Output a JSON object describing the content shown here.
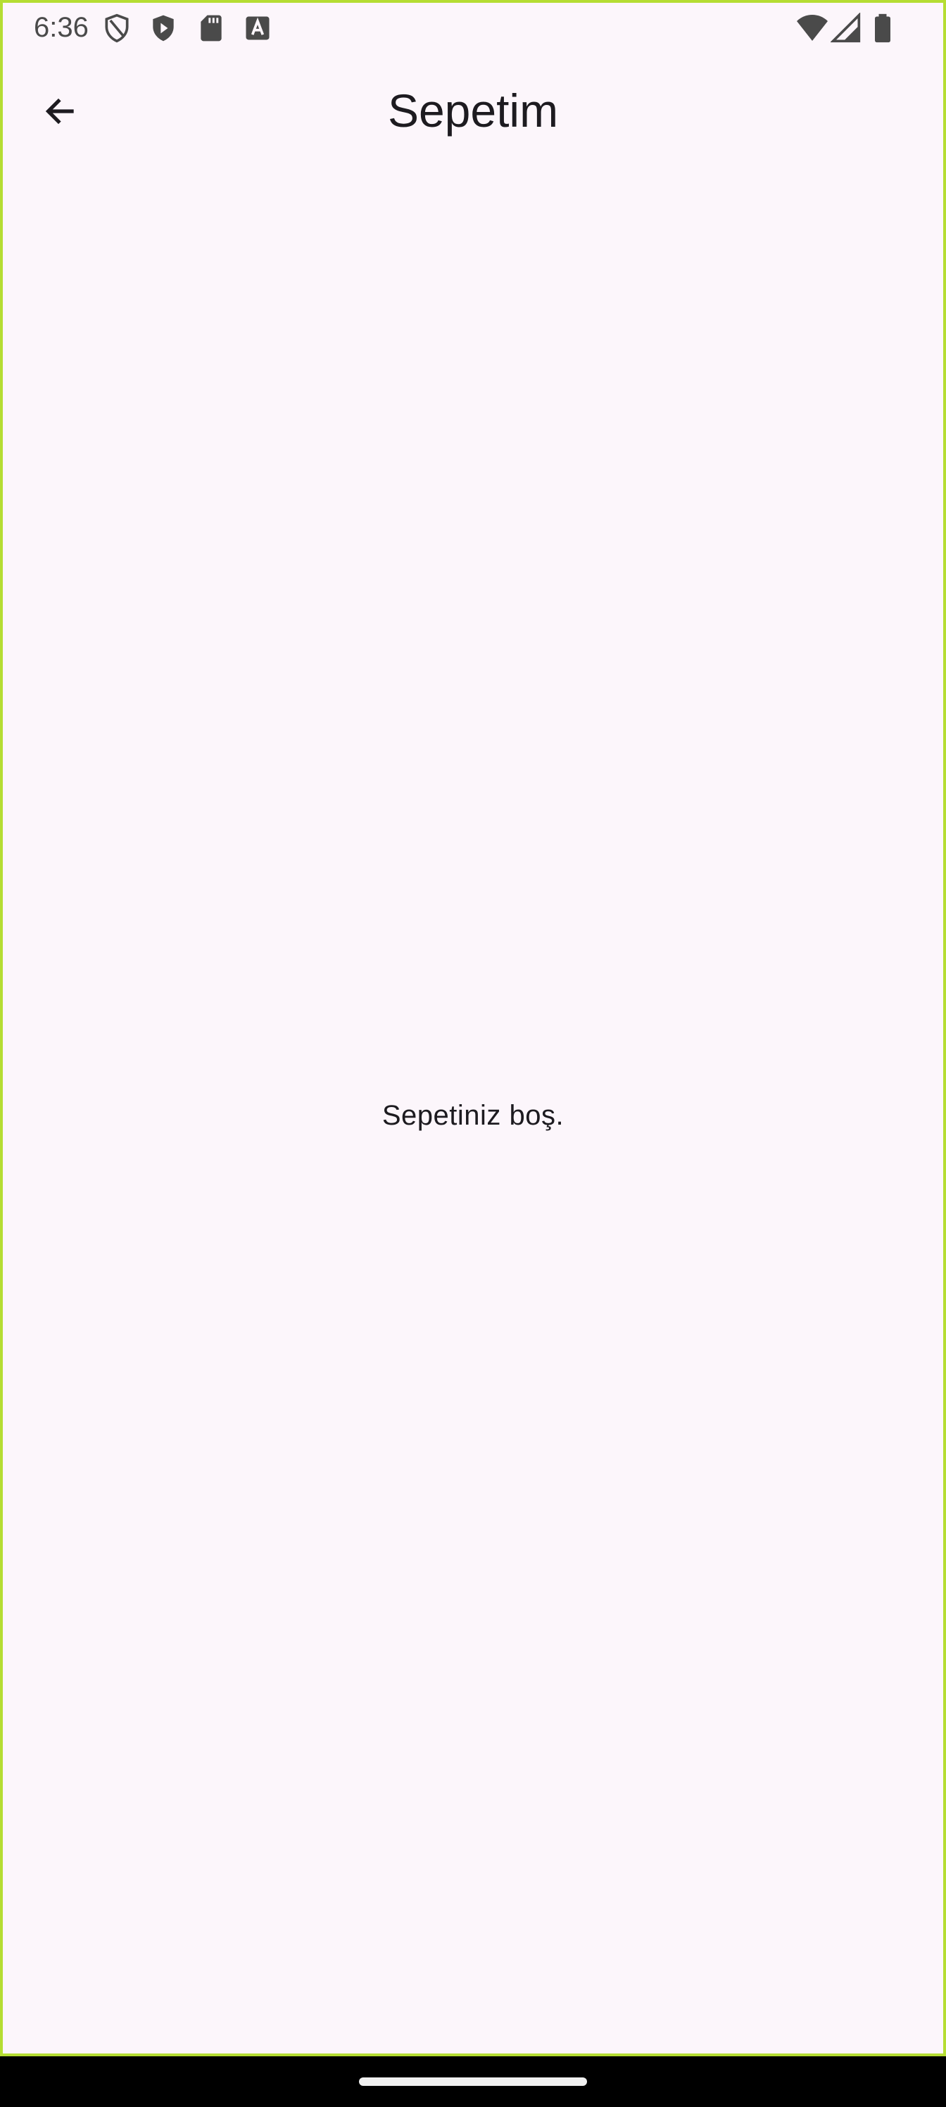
{
  "status_bar": {
    "time": "6:36",
    "left_icons": [
      "shield-outline-icon",
      "play-protect-icon",
      "sd-card-icon",
      "text-a-icon"
    ],
    "right_icons": [
      "wifi-icon",
      "signal-icon",
      "battery-icon"
    ]
  },
  "app_bar": {
    "back_icon": "arrow-left-icon",
    "title": "Sepetim"
  },
  "main": {
    "empty_message": "Sepetiniz boş."
  },
  "colors": {
    "background": "#fcf6fb",
    "frame_border": "#b5dd33",
    "text_primary": "#1d1b20",
    "status_text": "#4a4a4a",
    "nav_bar": "#000000"
  }
}
